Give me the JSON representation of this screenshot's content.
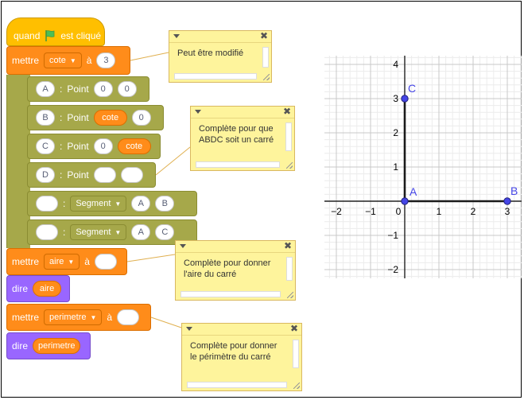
{
  "blocks": {
    "hat": {
      "when": "quand",
      "clicked": "est cliqué",
      "flag_color": "#4cbf56"
    },
    "set1": {
      "label": "mettre",
      "var": "cote",
      "to": "à",
      "value": "3"
    },
    "pointA": {
      "name": "A",
      "sep": ":",
      "type": "Point",
      "x": "0",
      "y": "0"
    },
    "pointB": {
      "name": "B",
      "sep": ":",
      "type": "Point",
      "x": "cote",
      "y": "0"
    },
    "pointC": {
      "name": "C",
      "sep": ":",
      "type": "Point",
      "x": "0",
      "y": "cote"
    },
    "pointD": {
      "name": "D",
      "sep": ":",
      "type": "Point",
      "x": "",
      "y": ""
    },
    "seg1": {
      "name": "",
      "sep": ":",
      "type": "Segment",
      "p1": "A",
      "p2": "B"
    },
    "seg2": {
      "name": "",
      "sep": ":",
      "type": "Segment",
      "p1": "A",
      "p2": "C"
    },
    "set2": {
      "label": "mettre",
      "var": "aire",
      "to": "à",
      "value": ""
    },
    "say1": {
      "label": "dire",
      "arg": "aire"
    },
    "set3": {
      "label": "mettre",
      "var": "perimetre",
      "to": "à",
      "value": ""
    },
    "say2": {
      "label": "dire",
      "arg": "perimetre"
    }
  },
  "comments": [
    {
      "line1": "Peut être modifié",
      "line2": ""
    },
    {
      "line1": "Complète pour que",
      "line2": "ABDC soit un carré"
    },
    {
      "line1": "Complète pour donner",
      "line2": "l'aire du carré"
    },
    {
      "line1": "Complète pour donner",
      "line2": "le périmètre du carré"
    }
  ],
  "graph": {
    "x_ticks": [
      "−2",
      "−1",
      "0",
      "1",
      "2",
      "3"
    ],
    "y_ticks": [
      "4",
      "3",
      "2",
      "1",
      "−1",
      "−2"
    ],
    "points": {
      "A": "A",
      "B": "B",
      "C": "C"
    },
    "point_color": "#4545e6"
  },
  "colors": {
    "events": "#ffbf00",
    "variables": "#ff8c1a",
    "extension": "#a6a84a",
    "looks": "#9966ff"
  }
}
